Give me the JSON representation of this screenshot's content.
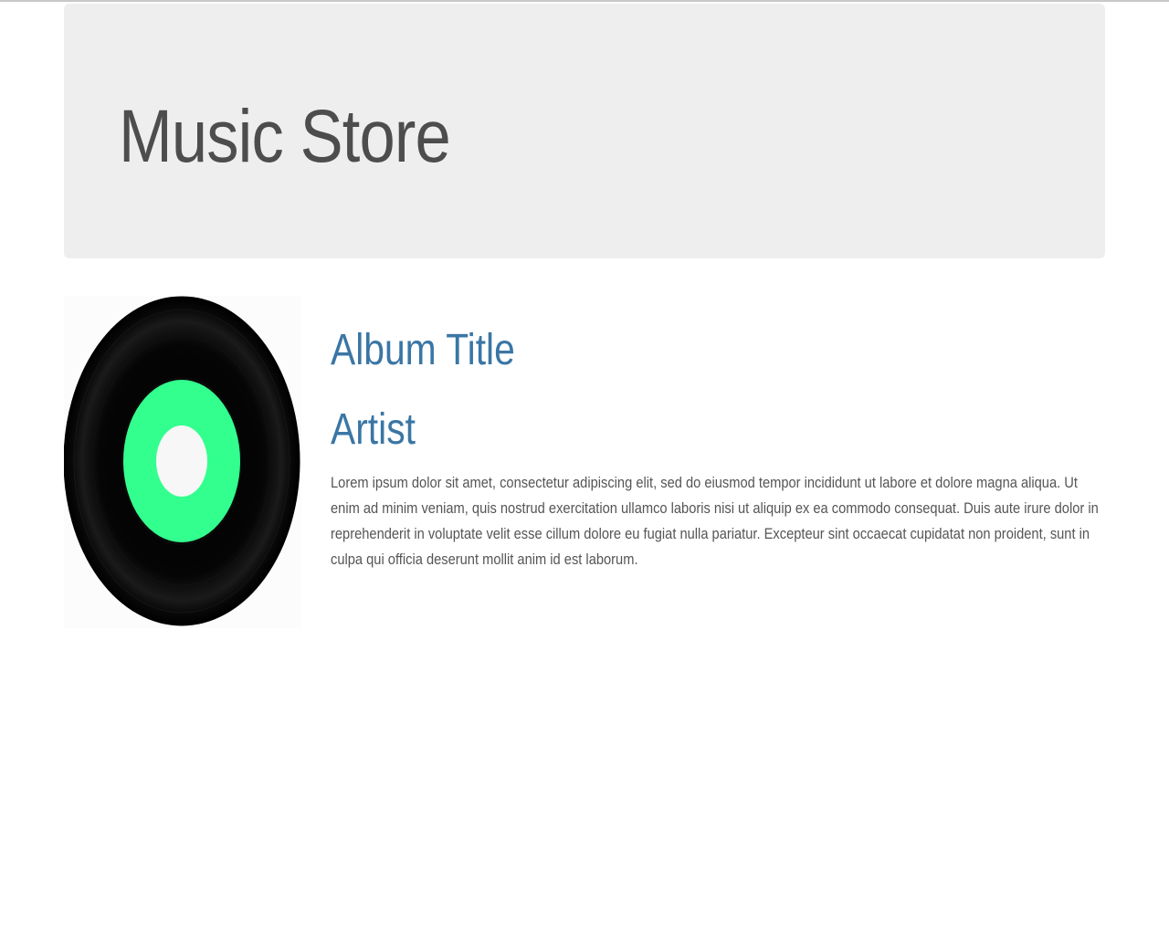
{
  "header": {
    "title": "Music Store"
  },
  "album": {
    "cover_icon": "vinyl-record-icon",
    "title": "Album Title",
    "artist": "Artist",
    "description": "Lorem ipsum dolor sit amet, consectetur adipiscing elit, sed do eiusmod tempor incididunt ut labore et dolore magna aliqua. Ut enim ad minim veniam, quis nostrud exercitation ullamco laboris nisi ut aliquip ex ea commodo consequat. Duis aute irure dolor in reprehenderit in voluptate velit esse cillum dolore eu fugiat nulla pariatur. Excepteur sint occaecat cupidatat non proident, sunt in culpa qui officia deserunt mollit anim id est laborum."
  },
  "colors": {
    "header_background": "#eeeeee",
    "header_text": "#4d4d4d",
    "heading_blue": "#3a76a5",
    "body_text": "#555555",
    "record_label_green": "#33ff8e"
  }
}
